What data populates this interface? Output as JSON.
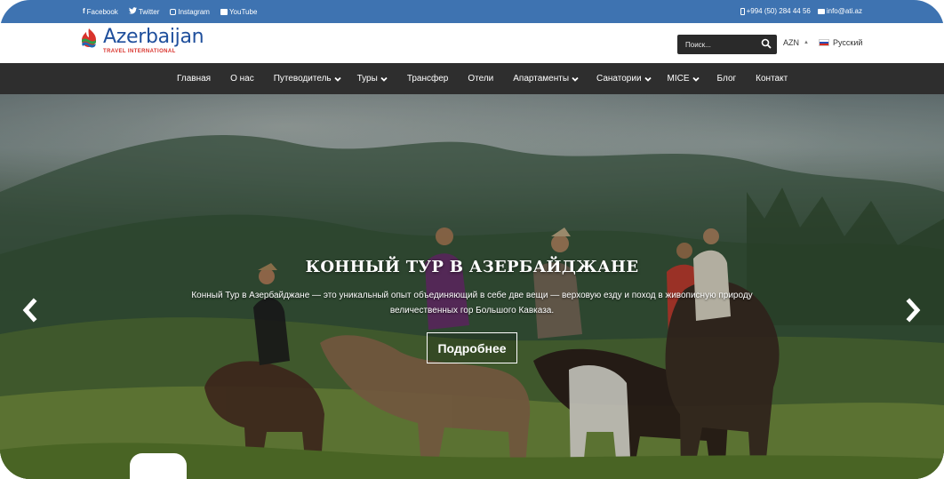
{
  "topbar": {
    "social": [
      {
        "label": "Facebook",
        "icon": "facebook-icon"
      },
      {
        "label": "Twitter",
        "icon": "twitter-icon"
      },
      {
        "label": "Instagram",
        "icon": "instagram-icon"
      },
      {
        "label": "YouTube",
        "icon": "youtube-icon"
      }
    ],
    "phone": "+994 (50) 284 44 56",
    "email": "info@ati.az",
    "bg_color": "#3e73b1"
  },
  "header": {
    "logo_title": "Azerbaijan",
    "logo_subtitle": "TRAVEL INTERNATIONAL",
    "search_placeholder": "Поиск...",
    "currency": "AZN",
    "language": "Русский"
  },
  "nav": {
    "items": [
      {
        "label": "Главная",
        "dropdown": false
      },
      {
        "label": "О нас",
        "dropdown": false
      },
      {
        "label": "Путеводитель",
        "dropdown": true
      },
      {
        "label": "Туры",
        "dropdown": true
      },
      {
        "label": "Трансфер",
        "dropdown": false
      },
      {
        "label": "Отели",
        "dropdown": false
      },
      {
        "label": "Апартаменты",
        "dropdown": true
      },
      {
        "label": "Санатории",
        "dropdown": true
      },
      {
        "label": "MICE",
        "dropdown": true
      },
      {
        "label": "Блог",
        "dropdown": false
      },
      {
        "label": "Контакт",
        "dropdown": false
      }
    ],
    "bg_color": "#2e2e2e"
  },
  "hero": {
    "title": "КОННЫЙ ТУР В АЗЕРБАЙДЖАНЕ",
    "description": "Конный Тур в Азербайджане — это уникальный опыт объединяющий в себе две вещи — верховую езду и поход в живописную природу величественных гор Большого Кавказа.",
    "button_label": "Подробнее",
    "prev_icon": "chevron-left-icon",
    "next_icon": "chevron-right-icon"
  }
}
